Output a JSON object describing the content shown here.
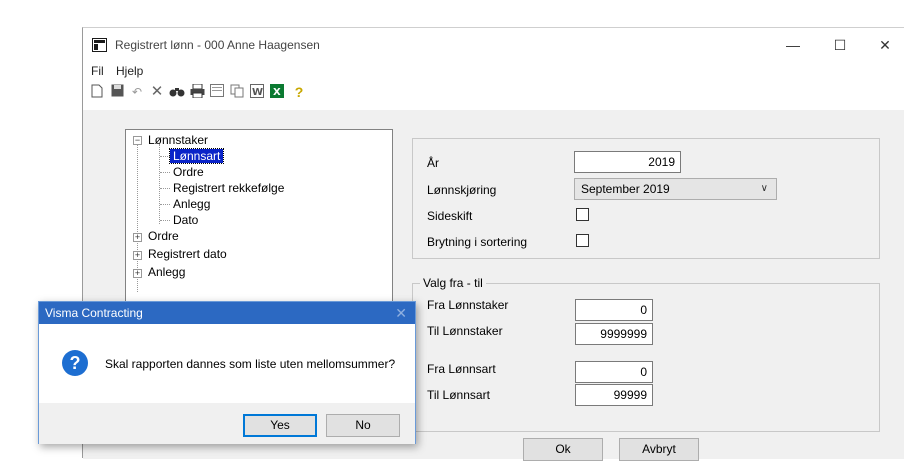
{
  "window": {
    "title": "Registrert lønn - 000 Anne Haagensen",
    "controls": {
      "minimize": "—",
      "maximize": "☐",
      "close": "✕"
    }
  },
  "menu": {
    "items": [
      "Fil",
      "Hjelp"
    ]
  },
  "toolbar": {
    "icons": [
      "new-icon",
      "save-icon",
      "undo-icon",
      "delete-icon",
      "find-icon",
      "print-icon",
      "preview-icon",
      "copy-icon",
      "word-icon",
      "excel-icon",
      "help-icon"
    ]
  },
  "tree": {
    "root": "Lønnstaker",
    "children": [
      "Lønnsart",
      "Ordre",
      "Registrert rekkefølge",
      "Anlegg",
      "Dato"
    ],
    "selected": "Lønnsart",
    "siblings": [
      "Ordre",
      "Registrert dato",
      "Anlegg"
    ]
  },
  "form": {
    "year_label": "År",
    "year_value": "2019",
    "run_label": "Lønnskjøring",
    "run_value": "September 2019",
    "pagebreak_label": "Sideskift",
    "break_sort_label": "Brytning i sortering"
  },
  "range": {
    "legend": "Valg fra - til",
    "from_employee_label": "Fra Lønnstaker",
    "from_employee_value": "0",
    "to_employee_label": "Til Lønnstaker",
    "to_employee_value": "9999999",
    "from_wage_label": "Fra Lønnsart",
    "from_wage_value": "0",
    "to_wage_label": "Til Lønnsart",
    "to_wage_value": "99999"
  },
  "buttons": {
    "ok": "Ok",
    "cancel": "Avbryt"
  },
  "dialog": {
    "title": "Visma Contracting",
    "close": "✕",
    "icon_glyph": "?",
    "message": "Skal rapporten dannes som liste uten mellomsummer?",
    "yes": "Yes",
    "no": "No"
  },
  "colors": {
    "selection": "#0a24c8",
    "dialog_title": "#2c69c2",
    "content_bg": "#f0f0f0"
  }
}
